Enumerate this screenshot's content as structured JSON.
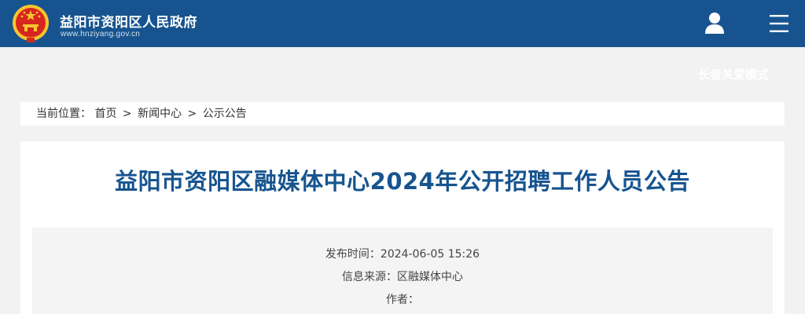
{
  "header": {
    "site_name": "益阳市资阳区人民政府",
    "site_url": "www.hnziyang.gov.cn",
    "emblem_icon": "national-emblem-icon",
    "user_icon": "user-icon",
    "menu_icon": "hamburger-menu-icon",
    "colors": {
      "bar": "#17548f",
      "emblem_red": "#d7261f",
      "emblem_gold": "#f6c52e"
    }
  },
  "elder_mode_label": "长者关爱模式",
  "breadcrumb": {
    "prefix": "当前位置：",
    "items": [
      "首页",
      "新闻中心",
      "公示公告"
    ],
    "separator": ">"
  },
  "article": {
    "title": "益阳市资阳区融媒体中心2024年公开招聘工作人员公告",
    "publish_time": "发布时间：2024-06-05 15:26",
    "source": "信息来源：区融媒体中心",
    "author": "作者："
  }
}
